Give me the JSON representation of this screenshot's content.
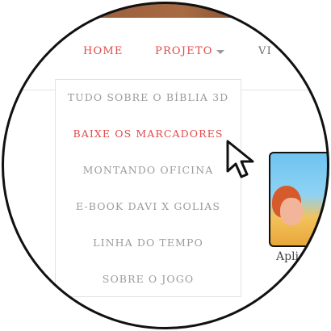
{
  "nav": {
    "home": "HOME",
    "projeto": "PROJETO",
    "next_partial": "VI"
  },
  "dropdown": {
    "items": [
      "TUDO SOBRE O BÍBLIA 3D",
      "BAIXE OS MARCADORES",
      "MONTANDO OFICINA",
      "E-BOOK DAVI X GOLIAS",
      "LINHA DO TEMPO",
      "SOBRE O JOGO"
    ],
    "active_index": 1
  },
  "card": {
    "label_partial": "Apli"
  },
  "colors": {
    "accent": "#e24a4a",
    "menu_text": "#9b9b9b",
    "ring": "#111111"
  },
  "icons": {
    "caret": "chevron-down-icon",
    "pointer": "mouse-pointer-icon"
  }
}
